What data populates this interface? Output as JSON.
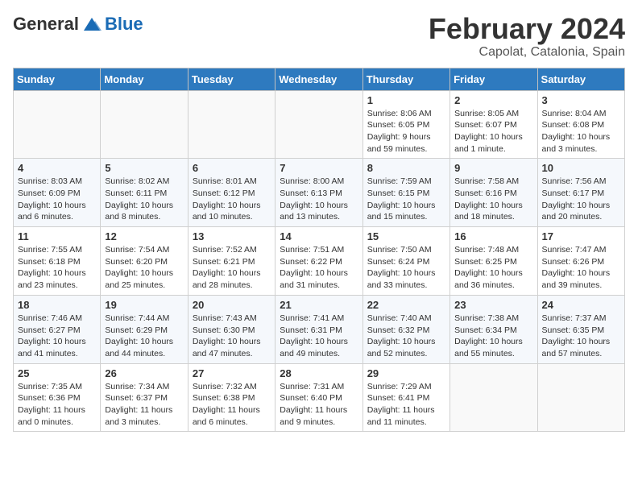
{
  "header": {
    "logo_general": "General",
    "logo_blue": "Blue",
    "title": "February 2024",
    "subtitle": "Capolat, Catalonia, Spain"
  },
  "calendar": {
    "days_of_week": [
      "Sunday",
      "Monday",
      "Tuesday",
      "Wednesday",
      "Thursday",
      "Friday",
      "Saturday"
    ],
    "weeks": [
      [
        {
          "day": "",
          "info": ""
        },
        {
          "day": "",
          "info": ""
        },
        {
          "day": "",
          "info": ""
        },
        {
          "day": "",
          "info": ""
        },
        {
          "day": "1",
          "info": "Sunrise: 8:06 AM\nSunset: 6:05 PM\nDaylight: 9 hours and 59 minutes."
        },
        {
          "day": "2",
          "info": "Sunrise: 8:05 AM\nSunset: 6:07 PM\nDaylight: 10 hours and 1 minute."
        },
        {
          "day": "3",
          "info": "Sunrise: 8:04 AM\nSunset: 6:08 PM\nDaylight: 10 hours and 3 minutes."
        }
      ],
      [
        {
          "day": "4",
          "info": "Sunrise: 8:03 AM\nSunset: 6:09 PM\nDaylight: 10 hours and 6 minutes."
        },
        {
          "day": "5",
          "info": "Sunrise: 8:02 AM\nSunset: 6:11 PM\nDaylight: 10 hours and 8 minutes."
        },
        {
          "day": "6",
          "info": "Sunrise: 8:01 AM\nSunset: 6:12 PM\nDaylight: 10 hours and 10 minutes."
        },
        {
          "day": "7",
          "info": "Sunrise: 8:00 AM\nSunset: 6:13 PM\nDaylight: 10 hours and 13 minutes."
        },
        {
          "day": "8",
          "info": "Sunrise: 7:59 AM\nSunset: 6:15 PM\nDaylight: 10 hours and 15 minutes."
        },
        {
          "day": "9",
          "info": "Sunrise: 7:58 AM\nSunset: 6:16 PM\nDaylight: 10 hours and 18 minutes."
        },
        {
          "day": "10",
          "info": "Sunrise: 7:56 AM\nSunset: 6:17 PM\nDaylight: 10 hours and 20 minutes."
        }
      ],
      [
        {
          "day": "11",
          "info": "Sunrise: 7:55 AM\nSunset: 6:18 PM\nDaylight: 10 hours and 23 minutes."
        },
        {
          "day": "12",
          "info": "Sunrise: 7:54 AM\nSunset: 6:20 PM\nDaylight: 10 hours and 25 minutes."
        },
        {
          "day": "13",
          "info": "Sunrise: 7:52 AM\nSunset: 6:21 PM\nDaylight: 10 hours and 28 minutes."
        },
        {
          "day": "14",
          "info": "Sunrise: 7:51 AM\nSunset: 6:22 PM\nDaylight: 10 hours and 31 minutes."
        },
        {
          "day": "15",
          "info": "Sunrise: 7:50 AM\nSunset: 6:24 PM\nDaylight: 10 hours and 33 minutes."
        },
        {
          "day": "16",
          "info": "Sunrise: 7:48 AM\nSunset: 6:25 PM\nDaylight: 10 hours and 36 minutes."
        },
        {
          "day": "17",
          "info": "Sunrise: 7:47 AM\nSunset: 6:26 PM\nDaylight: 10 hours and 39 minutes."
        }
      ],
      [
        {
          "day": "18",
          "info": "Sunrise: 7:46 AM\nSunset: 6:27 PM\nDaylight: 10 hours and 41 minutes."
        },
        {
          "day": "19",
          "info": "Sunrise: 7:44 AM\nSunset: 6:29 PM\nDaylight: 10 hours and 44 minutes."
        },
        {
          "day": "20",
          "info": "Sunrise: 7:43 AM\nSunset: 6:30 PM\nDaylight: 10 hours and 47 minutes."
        },
        {
          "day": "21",
          "info": "Sunrise: 7:41 AM\nSunset: 6:31 PM\nDaylight: 10 hours and 49 minutes."
        },
        {
          "day": "22",
          "info": "Sunrise: 7:40 AM\nSunset: 6:32 PM\nDaylight: 10 hours and 52 minutes."
        },
        {
          "day": "23",
          "info": "Sunrise: 7:38 AM\nSunset: 6:34 PM\nDaylight: 10 hours and 55 minutes."
        },
        {
          "day": "24",
          "info": "Sunrise: 7:37 AM\nSunset: 6:35 PM\nDaylight: 10 hours and 57 minutes."
        }
      ],
      [
        {
          "day": "25",
          "info": "Sunrise: 7:35 AM\nSunset: 6:36 PM\nDaylight: 11 hours and 0 minutes."
        },
        {
          "day": "26",
          "info": "Sunrise: 7:34 AM\nSunset: 6:37 PM\nDaylight: 11 hours and 3 minutes."
        },
        {
          "day": "27",
          "info": "Sunrise: 7:32 AM\nSunset: 6:38 PM\nDaylight: 11 hours and 6 minutes."
        },
        {
          "day": "28",
          "info": "Sunrise: 7:31 AM\nSunset: 6:40 PM\nDaylight: 11 hours and 9 minutes."
        },
        {
          "day": "29",
          "info": "Sunrise: 7:29 AM\nSunset: 6:41 PM\nDaylight: 11 hours and 11 minutes."
        },
        {
          "day": "",
          "info": ""
        },
        {
          "day": "",
          "info": ""
        }
      ]
    ]
  }
}
